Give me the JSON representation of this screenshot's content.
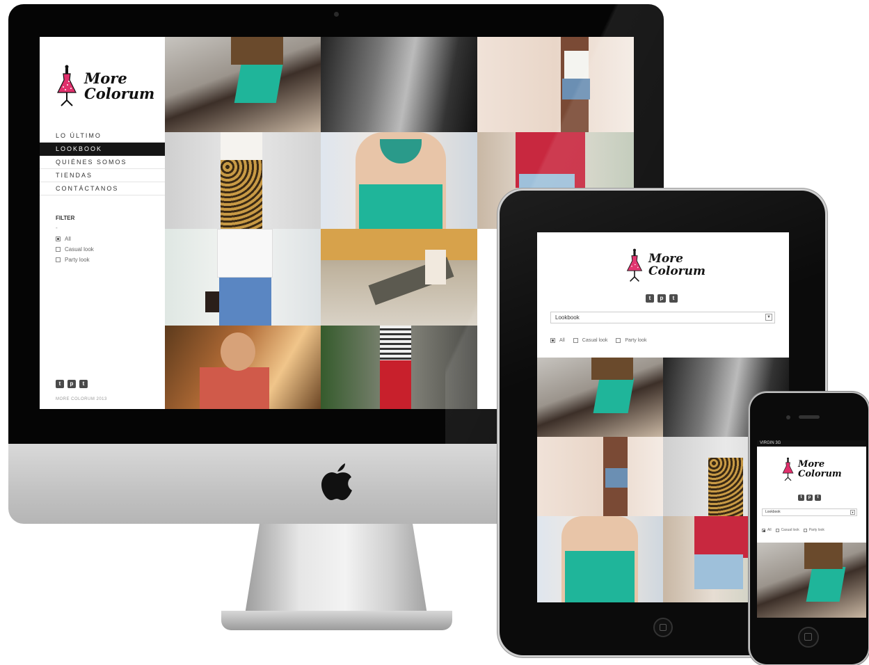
{
  "brand": {
    "line1": "More",
    "line2": "Colorum"
  },
  "nav": {
    "items": [
      {
        "label": "LO ÚLTIMO"
      },
      {
        "label": "LOOKBOOK"
      },
      {
        "label": "QUIÉNES SOMOS"
      },
      {
        "label": "TIENDAS"
      },
      {
        "label": "CONTÁCTANOS"
      }
    ],
    "active_index": 1
  },
  "filter": {
    "title": "FILTER",
    "dash": "-",
    "options": [
      {
        "label": "All",
        "checked": true
      },
      {
        "label": "Casual look",
        "checked": false
      },
      {
        "label": "Party look",
        "checked": false
      }
    ]
  },
  "social": {
    "icons": [
      "twitter-icon",
      "pinterest-icon",
      "tumblr-icon"
    ],
    "glyphs": [
      "t",
      "p",
      "t"
    ]
  },
  "footer": {
    "copyright": "MORE COLORUM 2013"
  },
  "mobile": {
    "select_value": "Lookbook",
    "status_bar": "VIRGIN 3G"
  },
  "colors": {
    "accent": "#e0306c",
    "teal": "#1fb59a",
    "nav_active_bg": "#151515"
  }
}
